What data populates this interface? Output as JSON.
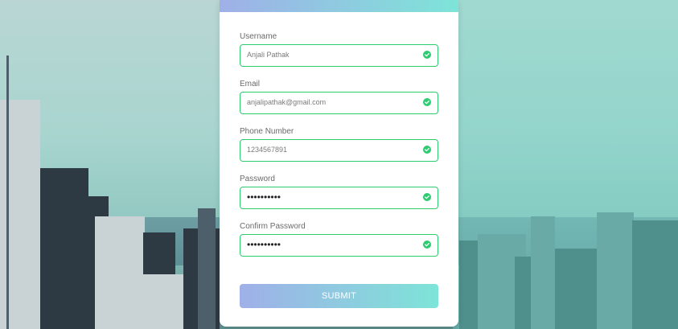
{
  "form": {
    "fields": [
      {
        "label": "Username",
        "value": "Anjali Pathak",
        "valid": true
      },
      {
        "label": "Email",
        "value": "anjalipathak@gmail.com",
        "valid": true
      },
      {
        "label": "Phone Number",
        "value": "1234567891",
        "valid": true
      },
      {
        "label": "Password",
        "value": "••••••••••",
        "valid": true
      },
      {
        "label": "Confirm Password",
        "value": "••••••••••",
        "valid": true
      }
    ],
    "submit_label": "SUBMIT"
  },
  "colors": {
    "valid": "#2ecc71",
    "gradient_start": "#9fb0e8",
    "gradient_end": "#7ee4d8"
  },
  "icons": {
    "field_status": "check-circle-icon"
  }
}
